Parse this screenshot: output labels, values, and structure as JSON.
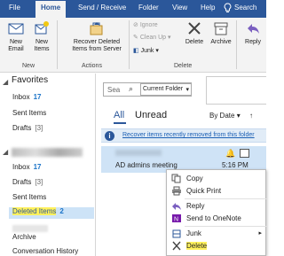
{
  "tabs": [
    "File",
    "Home",
    "Send / Receive",
    "Folder",
    "View",
    "Help",
    "Search"
  ],
  "ribbon": {
    "new_email": "New\nEmail",
    "new_items": "New\nItems",
    "new_group": "New",
    "recover": "Recover Deleted\nItems from Server",
    "actions_group": "Actions",
    "ignore": "Ignore",
    "clean_up": "Clean Up",
    "junk": "Junk",
    "delete": "Delete",
    "archive": "Archive",
    "delete_group": "Delete",
    "reply": "Reply"
  },
  "folders": {
    "favorites": "Favorites",
    "fav_items": [
      {
        "label": "Inbox",
        "count": "17",
        "grey": false
      },
      {
        "label": "Sent Items",
        "count": "",
        "grey": false
      },
      {
        "label": "Drafts",
        "count": "[3]",
        "grey": true
      }
    ],
    "account_items": [
      {
        "label": "Inbox",
        "count": "17",
        "grey": false
      },
      {
        "label": "Drafts",
        "count": "[3]",
        "grey": true
      },
      {
        "label": "Sent Items",
        "count": "",
        "grey": false
      }
    ],
    "deleted_label": "Deleted Items",
    "deleted_count": "2",
    "archive": "Archive",
    "conversation_history": "Conversation History"
  },
  "list": {
    "search_placeholder": "Sea",
    "folder_scope": "Current Folder",
    "all": "All",
    "unread": "Unread",
    "sort": "By Date",
    "recover_link": "Recover items recently removed from this folder",
    "message": {
      "subject": "AD admins meeting",
      "time": "5:16 PM"
    }
  },
  "context_menu": [
    "Copy",
    "Quick Print",
    "Reply",
    "Send to OneNote",
    "Junk",
    "Delete"
  ],
  "colors": {
    "accent": "#2b579a",
    "highlight": "#fff15c",
    "selected": "#cfe3f6"
  }
}
